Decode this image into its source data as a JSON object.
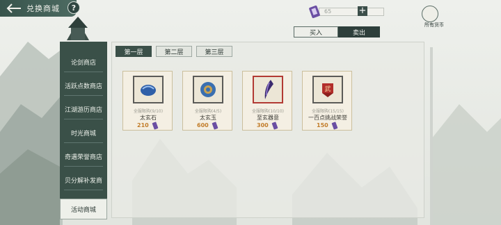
{
  "header": {
    "title": "兑换商城",
    "help_label": "?"
  },
  "currency": {
    "amount": "65",
    "plus_label": "+"
  },
  "owned": {
    "label": "所有货币"
  },
  "trade": {
    "buy": "买入",
    "sell": "卖出"
  },
  "sidebar": {
    "items": [
      {
        "label": "论剑商店"
      },
      {
        "label": "活跃点数商店"
      },
      {
        "label": "江湖游历商店"
      },
      {
        "label": "时光商城"
      },
      {
        "label": "奇遇荣誉商店"
      },
      {
        "label": "贝分解补发商"
      },
      {
        "label": "活动商城"
      }
    ],
    "active_index": 6
  },
  "floors": {
    "tabs": [
      "第一层",
      "第二层",
      "第三层"
    ],
    "active_index": 0
  },
  "items": [
    {
      "limit": "全服限购(9/10)",
      "name": "太玄石",
      "price": "210"
    },
    {
      "limit": "全服限购(4/5)",
      "name": "太玄玉",
      "price": "600"
    },
    {
      "limit": "全服限购(10/10)",
      "name": "至玄器意",
      "price": "300"
    },
    {
      "limit": "全服限购(15/15)",
      "name": "一百点挑战荣誉",
      "price": "150"
    }
  ],
  "colors": {
    "sidebar": "#3a5048",
    "accent": "#3b5049",
    "price": "#c27d2a",
    "token": "#6b4fa3"
  }
}
